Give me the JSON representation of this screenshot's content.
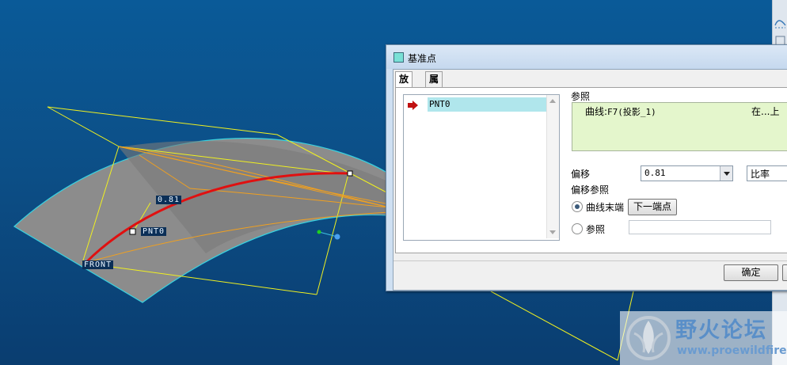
{
  "viewport": {
    "labels": {
      "offset_value": "0.81",
      "point_name": "PNT0",
      "plane_name": "FRONT"
    },
    "colors": {
      "background": "#0b5a96",
      "surface": "#8a8a8a",
      "curve": "#e01010",
      "datum_lines": "#f0f020",
      "edge": "#40d8e0"
    }
  },
  "dialog": {
    "title": "基准点",
    "tabs": [
      {
        "label": "放置",
        "active": true
      },
      {
        "label": "属性",
        "active": false
      }
    ],
    "points_list": {
      "items": [
        "PNT0"
      ]
    },
    "references": {
      "label": "参照",
      "curve_prefix": "曲线:",
      "curve_name": "F7(投影_1)",
      "ref_type": "在...上"
    },
    "offset": {
      "label": "偏移",
      "value": "0.81",
      "mode": "比率"
    },
    "offset_reference": {
      "label": "偏移参照",
      "options": [
        {
          "label": "曲线末端",
          "selected": true,
          "button": "下一端点"
        },
        {
          "label": "参照",
          "selected": false
        }
      ]
    },
    "buttons": {
      "ok": "确定"
    }
  },
  "watermark": {
    "title": "野火论坛",
    "url": "www.proewildfire.cn"
  }
}
